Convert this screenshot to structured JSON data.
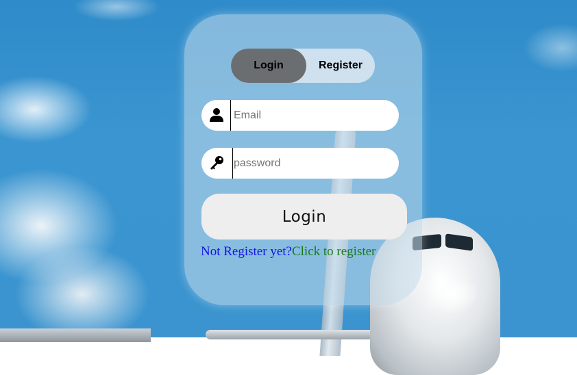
{
  "toggle": {
    "login_label": "Login",
    "register_label": "Register",
    "active": "Login"
  },
  "form": {
    "email_placeholder": "Email",
    "email_value": "",
    "password_placeholder": "password",
    "password_value": "",
    "submit_label": "Login"
  },
  "register_prompt": {
    "question": "Not Register yet?",
    "link": "Click to register"
  },
  "icons": {
    "email": "user-icon",
    "password": "key-icon"
  },
  "colors": {
    "question_text": "#1414e6",
    "link_text": "#1a7a1a",
    "active_toggle": "#6b6e70"
  }
}
